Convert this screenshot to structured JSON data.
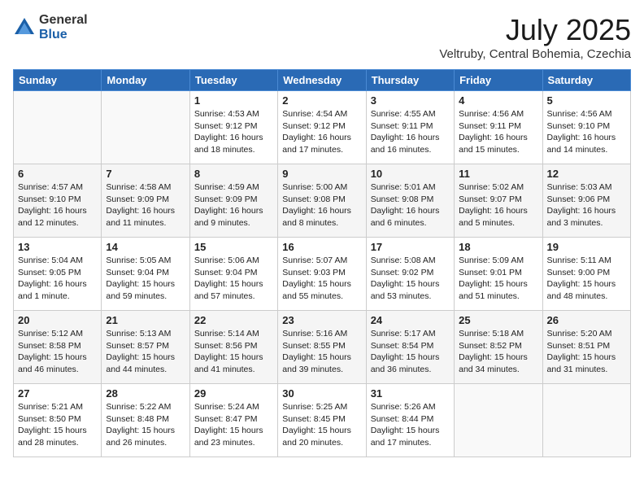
{
  "logo": {
    "general": "General",
    "blue": "Blue"
  },
  "title": "July 2025",
  "subtitle": "Veltruby, Central Bohemia, Czechia",
  "headers": [
    "Sunday",
    "Monday",
    "Tuesday",
    "Wednesday",
    "Thursday",
    "Friday",
    "Saturday"
  ],
  "weeks": [
    [
      {
        "day": "",
        "info": ""
      },
      {
        "day": "",
        "info": ""
      },
      {
        "day": "1",
        "info": "Sunrise: 4:53 AM\nSunset: 9:12 PM\nDaylight: 16 hours and 18 minutes."
      },
      {
        "day": "2",
        "info": "Sunrise: 4:54 AM\nSunset: 9:12 PM\nDaylight: 16 hours and 17 minutes."
      },
      {
        "day": "3",
        "info": "Sunrise: 4:55 AM\nSunset: 9:11 PM\nDaylight: 16 hours and 16 minutes."
      },
      {
        "day": "4",
        "info": "Sunrise: 4:56 AM\nSunset: 9:11 PM\nDaylight: 16 hours and 15 minutes."
      },
      {
        "day": "5",
        "info": "Sunrise: 4:56 AM\nSunset: 9:10 PM\nDaylight: 16 hours and 14 minutes."
      }
    ],
    [
      {
        "day": "6",
        "info": "Sunrise: 4:57 AM\nSunset: 9:10 PM\nDaylight: 16 hours and 12 minutes."
      },
      {
        "day": "7",
        "info": "Sunrise: 4:58 AM\nSunset: 9:09 PM\nDaylight: 16 hours and 11 minutes."
      },
      {
        "day": "8",
        "info": "Sunrise: 4:59 AM\nSunset: 9:09 PM\nDaylight: 16 hours and 9 minutes."
      },
      {
        "day": "9",
        "info": "Sunrise: 5:00 AM\nSunset: 9:08 PM\nDaylight: 16 hours and 8 minutes."
      },
      {
        "day": "10",
        "info": "Sunrise: 5:01 AM\nSunset: 9:08 PM\nDaylight: 16 hours and 6 minutes."
      },
      {
        "day": "11",
        "info": "Sunrise: 5:02 AM\nSunset: 9:07 PM\nDaylight: 16 hours and 5 minutes."
      },
      {
        "day": "12",
        "info": "Sunrise: 5:03 AM\nSunset: 9:06 PM\nDaylight: 16 hours and 3 minutes."
      }
    ],
    [
      {
        "day": "13",
        "info": "Sunrise: 5:04 AM\nSunset: 9:05 PM\nDaylight: 16 hours and 1 minute."
      },
      {
        "day": "14",
        "info": "Sunrise: 5:05 AM\nSunset: 9:04 PM\nDaylight: 15 hours and 59 minutes."
      },
      {
        "day": "15",
        "info": "Sunrise: 5:06 AM\nSunset: 9:04 PM\nDaylight: 15 hours and 57 minutes."
      },
      {
        "day": "16",
        "info": "Sunrise: 5:07 AM\nSunset: 9:03 PM\nDaylight: 15 hours and 55 minutes."
      },
      {
        "day": "17",
        "info": "Sunrise: 5:08 AM\nSunset: 9:02 PM\nDaylight: 15 hours and 53 minutes."
      },
      {
        "day": "18",
        "info": "Sunrise: 5:09 AM\nSunset: 9:01 PM\nDaylight: 15 hours and 51 minutes."
      },
      {
        "day": "19",
        "info": "Sunrise: 5:11 AM\nSunset: 9:00 PM\nDaylight: 15 hours and 48 minutes."
      }
    ],
    [
      {
        "day": "20",
        "info": "Sunrise: 5:12 AM\nSunset: 8:58 PM\nDaylight: 15 hours and 46 minutes."
      },
      {
        "day": "21",
        "info": "Sunrise: 5:13 AM\nSunset: 8:57 PM\nDaylight: 15 hours and 44 minutes."
      },
      {
        "day": "22",
        "info": "Sunrise: 5:14 AM\nSunset: 8:56 PM\nDaylight: 15 hours and 41 minutes."
      },
      {
        "day": "23",
        "info": "Sunrise: 5:16 AM\nSunset: 8:55 PM\nDaylight: 15 hours and 39 minutes."
      },
      {
        "day": "24",
        "info": "Sunrise: 5:17 AM\nSunset: 8:54 PM\nDaylight: 15 hours and 36 minutes."
      },
      {
        "day": "25",
        "info": "Sunrise: 5:18 AM\nSunset: 8:52 PM\nDaylight: 15 hours and 34 minutes."
      },
      {
        "day": "26",
        "info": "Sunrise: 5:20 AM\nSunset: 8:51 PM\nDaylight: 15 hours and 31 minutes."
      }
    ],
    [
      {
        "day": "27",
        "info": "Sunrise: 5:21 AM\nSunset: 8:50 PM\nDaylight: 15 hours and 28 minutes."
      },
      {
        "day": "28",
        "info": "Sunrise: 5:22 AM\nSunset: 8:48 PM\nDaylight: 15 hours and 26 minutes."
      },
      {
        "day": "29",
        "info": "Sunrise: 5:24 AM\nSunset: 8:47 PM\nDaylight: 15 hours and 23 minutes."
      },
      {
        "day": "30",
        "info": "Sunrise: 5:25 AM\nSunset: 8:45 PM\nDaylight: 15 hours and 20 minutes."
      },
      {
        "day": "31",
        "info": "Sunrise: 5:26 AM\nSunset: 8:44 PM\nDaylight: 15 hours and 17 minutes."
      },
      {
        "day": "",
        "info": ""
      },
      {
        "day": "",
        "info": ""
      }
    ]
  ]
}
